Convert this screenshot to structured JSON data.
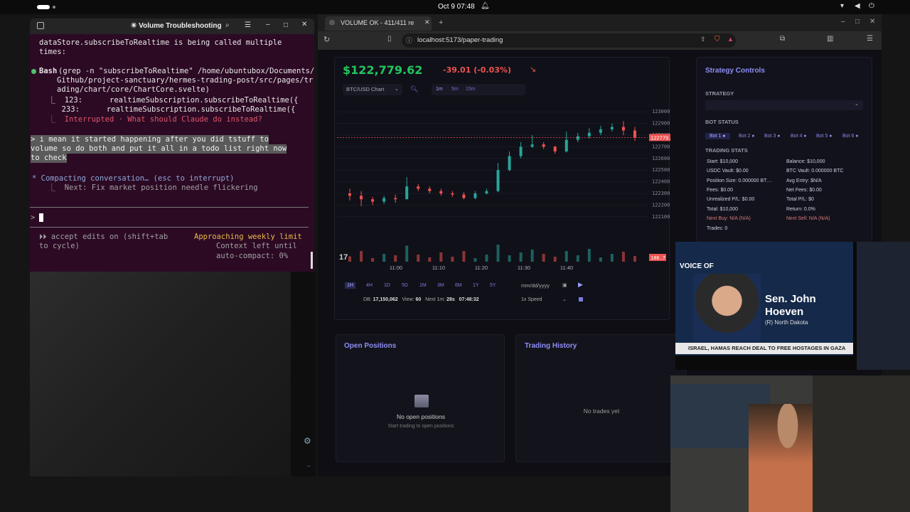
{
  "topbar": {
    "datetime": "Oct 9  07:48"
  },
  "terminal": {
    "title": "✳ Volume Troubleshooting",
    "lines": {
      "l1": "dataStore.subscribeToRealtime is being called multiple",
      "l2": "times:",
      "bash_label": "Bash",
      "bash_cmd1": "(grep -n \"subscribeToRealtime\" /home/ubuntubox/Documents/",
      "bash_cmd2": "Github/project-sanctuary/hermes-trading-post/src/pages/tr",
      "bash_cmd3": "ading/chart/core/ChartCore.svelte)",
      "res1": "  ⎿  123:      realtimeSubscription.subscribeToRealtime({",
      "res2": "     233:      realtimeSubscription.subscribeToRealtime({",
      "interrupted": "  ⎿  Interrupted · What should Claude do instead?",
      "user1": "> i mean it started happening after you did tstuff to",
      "user2": "volume so do both and put it all in a todo list right now",
      "user3": "to check",
      "compacting": "* Compacting conversation… (esc to interrupt)",
      "next": "  ⎿  Next: Fix market position needle flickering",
      "prompt": ">",
      "accept1": "⏵⏵ accept edits on (shift+tab",
      "accept2": "to cycle)",
      "limit": "Approaching weekly limit",
      "ctx1": "Context left until",
      "ctx2": "auto-compact: 0%"
    }
  },
  "browser": {
    "tab_title": "VOLUME OK - 411/411 re",
    "url": "localhost:5173/paper-trading"
  },
  "app": {
    "price": "$122,779.62",
    "change": "-39.01 (-0.03%)",
    "change_arrow": "↘",
    "chart_select": "BTC/USD Chart",
    "timeframes": [
      "1m",
      "5m",
      "15m"
    ],
    "ranges": [
      "1H",
      "4H",
      "1D",
      "5D",
      "1M",
      "3M",
      "6M",
      "1Y",
      "5Y"
    ],
    "date_placeholder": "mm/dd/yyyy",
    "speed": "1x Speed",
    "stats_line": {
      "db_label": "DB:",
      "db": "17,150,062",
      "view_label": "View:",
      "view": "60",
      "next_label": "Next 1m:",
      "next": "28s",
      "time": "07:48:32"
    },
    "strategy": {
      "title": "Strategy Controls",
      "strategy_label": "STRATEGY",
      "bot_status_label": "BOT STATUS",
      "bots": [
        "Bot 1 ●",
        "Bot 2 ●",
        "Bot 3 ●",
        "Bot 4 ●",
        "Bot 5 ●",
        "Bot 6 ●"
      ],
      "trading_stats_label": "TRADING STATS",
      "left": [
        "Start: $10,000",
        "USDC Vault: $0.00",
        "Position Size: 0.000000 BT…",
        "Fees: $0.00",
        "Unrealized P/L: $0.00",
        "Total: $10,000",
        "Next Buy: N/A (N/A)",
        "Trades: 0"
      ],
      "right": [
        "Balance: $10,000",
        "BTC Vault: 0.000000 BTC",
        "Avg Entry: $N/A",
        "Net Fees: $0.00",
        "Total P/L: $0",
        "Return: 0.0%",
        "Next Sell: N/A (N/A)"
      ]
    },
    "open_positions": {
      "title": "Open Positions",
      "empty": "No open positions",
      "sub": "Start trading to open positions"
    },
    "trading_history": {
      "title": "Trading History",
      "empty": "No trades yet"
    }
  },
  "chart_data": {
    "type": "candlestick",
    "xlabel": "",
    "ylabel": "",
    "x_ticks": [
      "11:00",
      "11:10",
      "11:20",
      "11:30",
      "11:40"
    ],
    "y_ticks": [
      123000,
      122900,
      122800,
      122700,
      122600,
      122500,
      122400,
      122300,
      122200,
      122100
    ],
    "ylim": [
      122050,
      123050
    ],
    "last_price_label": "122779.62",
    "volume_label": "106.7",
    "candles": [
      {
        "t": "10:52",
        "o": 122300,
        "c": 122280,
        "h": 122340,
        "l": 122240
      },
      {
        "t": "10:54",
        "o": 122280,
        "c": 122250,
        "h": 122320,
        "l": 122190
      },
      {
        "t": "10:56",
        "o": 122250,
        "c": 122230,
        "h": 122270,
        "l": 122200
      },
      {
        "t": "10:58",
        "o": 122230,
        "c": 122260,
        "h": 122280,
        "l": 122210
      },
      {
        "t": "11:00",
        "o": 122260,
        "c": 122250,
        "h": 122290,
        "l": 122220
      },
      {
        "t": "11:02",
        "o": 122250,
        "c": 122360,
        "h": 122440,
        "l": 122250
      },
      {
        "t": "11:04",
        "o": 122360,
        "c": 122340,
        "h": 122380,
        "l": 122320
      },
      {
        "t": "11:06",
        "o": 122340,
        "c": 122320,
        "h": 122360,
        "l": 122300
      },
      {
        "t": "11:08",
        "o": 122320,
        "c": 122300,
        "h": 122340,
        "l": 122280
      },
      {
        "t": "11:10",
        "o": 122300,
        "c": 122290,
        "h": 122320,
        "l": 122270
      },
      {
        "t": "11:12",
        "o": 122290,
        "c": 122260,
        "h": 122310,
        "l": 122250
      },
      {
        "t": "11:14",
        "o": 122260,
        "c": 122300,
        "h": 122320,
        "l": 122250
      },
      {
        "t": "11:16",
        "o": 122300,
        "c": 122320,
        "h": 122340,
        "l": 122290
      },
      {
        "t": "11:18",
        "o": 122320,
        "c": 122500,
        "h": 122560,
        "l": 122310
      },
      {
        "t": "11:20",
        "o": 122500,
        "c": 122620,
        "h": 122660,
        "l": 122490
      },
      {
        "t": "11:22",
        "o": 122620,
        "c": 122700,
        "h": 122740,
        "l": 122600
      },
      {
        "t": "11:24",
        "o": 122700,
        "c": 122720,
        "h": 122800,
        "l": 122690
      },
      {
        "t": "11:26",
        "o": 122720,
        "c": 122700,
        "h": 122740,
        "l": 122680
      },
      {
        "t": "11:28",
        "o": 122700,
        "c": 122660,
        "h": 122710,
        "l": 122640
      },
      {
        "t": "11:30",
        "o": 122660,
        "c": 122760,
        "h": 122830,
        "l": 122650
      },
      {
        "t": "11:32",
        "o": 122760,
        "c": 122790,
        "h": 122820,
        "l": 122740
      },
      {
        "t": "11:34",
        "o": 122790,
        "c": 122820,
        "h": 122860,
        "l": 122770
      },
      {
        "t": "11:36",
        "o": 122820,
        "c": 122850,
        "h": 122880,
        "l": 122800
      },
      {
        "t": "11:38",
        "o": 122850,
        "c": 122870,
        "h": 122900,
        "l": 122830
      },
      {
        "t": "11:40",
        "o": 122870,
        "c": 122840,
        "h": 122920,
        "l": 122800
      },
      {
        "t": "11:42",
        "o": 122840,
        "c": 122780,
        "h": 122870,
        "l": 122750
      }
    ],
    "volumes": [
      15,
      30,
      10,
      22,
      18,
      45,
      20,
      12,
      26,
      14,
      30,
      10,
      20,
      48,
      18,
      26,
      34,
      22,
      14,
      30,
      18,
      36,
      12,
      22,
      28,
      16
    ]
  },
  "video": {
    "news_label": "VOICE OF",
    "name1": "Sen. John",
    "name2": "Hoeven",
    "party": "(R) North Dakota",
    "ticker": "ISRAEL, HAMAS REACH DEAL TO FREE HOSTAGES IN GAZA"
  },
  "colors": {
    "up": "#26a69a",
    "down": "#ef5350",
    "accent": "#7c7cf0",
    "price_green": "#22c55e"
  }
}
